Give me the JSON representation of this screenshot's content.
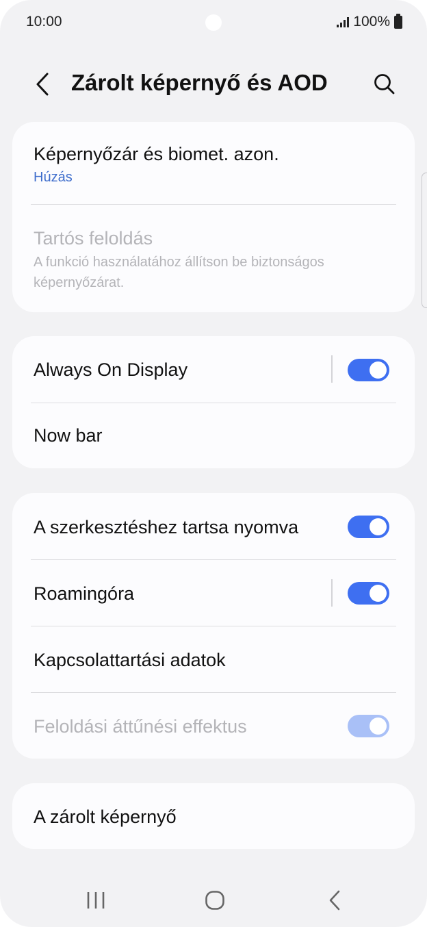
{
  "status_bar": {
    "time": "10:00",
    "battery_text": "100%",
    "icons": [
      "signal-icon",
      "battery-icon"
    ]
  },
  "header": {
    "title": "Zárolt képernyő és AOD",
    "back_icon": "back-arrow-icon",
    "search_icon": "search-icon"
  },
  "sections": {
    "security": {
      "screen_lock": {
        "title": "Képernyőzár és biomet. azon.",
        "subtitle": "Húzás",
        "subtitle_color": "#3e6dcc"
      },
      "extend_unlock": {
        "title": "Tartós feloldás",
        "subtitle_line1": "A funkció használatához állítson be biztonságos",
        "subtitle_line2": "képernyőzárat.",
        "enabled": false
      }
    },
    "display": {
      "aod": {
        "title": "Always On Display",
        "toggle_on": true
      },
      "now_bar": {
        "title": "Now bar"
      }
    },
    "options": {
      "edit_hold": {
        "title": "A szerkesztéshez tartsa nyomva",
        "toggle_on": true
      },
      "roaming_clock": {
        "title": "Roamingóra",
        "toggle_on": true
      },
      "contact_info": {
        "title": "Kapcsolattartási adatok"
      },
      "unlock_effect": {
        "title": "Feloldási áttűnési effektus",
        "toggle_on": true,
        "enabled": false
      }
    },
    "about": {
      "lock_screen": {
        "title": "A zárolt képernyő"
      }
    }
  },
  "nav_bar": {
    "recents_icon": "recents-icon",
    "home_icon": "home-icon",
    "back_icon": "back-icon"
  },
  "colors": {
    "accent": "#3e6ff1",
    "accent_disabled": "#a9c0f7",
    "background": "#f2f2f4",
    "card": "#fcfcfe",
    "link": "#3e6dcc"
  }
}
